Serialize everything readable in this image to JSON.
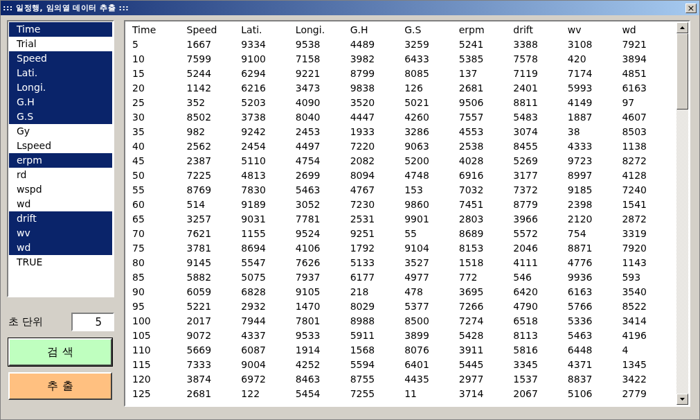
{
  "window": {
    "title": "::: 일정행, 임의열 데이터 추출 :::",
    "close": "×"
  },
  "field_list": {
    "items": [
      {
        "label": "Time",
        "selected": true
      },
      {
        "label": "Trial",
        "selected": false
      },
      {
        "label": "Speed",
        "selected": true
      },
      {
        "label": "Lati.",
        "selected": true
      },
      {
        "label": "Longi.",
        "selected": true
      },
      {
        "label": "G.H",
        "selected": true
      },
      {
        "label": "G.S",
        "selected": true
      },
      {
        "label": "Gy",
        "selected": false
      },
      {
        "label": "Lspeed",
        "selected": false
      },
      {
        "label": "erpm",
        "selected": true
      },
      {
        "label": "rd",
        "selected": false
      },
      {
        "label": "wspd",
        "selected": false
      },
      {
        "label": "wd",
        "selected": false
      },
      {
        "label": "drift",
        "selected": true
      },
      {
        "label": "wv",
        "selected": true
      },
      {
        "label": "wd",
        "selected": true
      },
      {
        "label": "TRUE",
        "selected": false
      }
    ]
  },
  "interval": {
    "label": "초 단위",
    "value": "5"
  },
  "buttons": [
    {
      "label": "검 색",
      "color": "#bfffbf",
      "focused": true
    },
    {
      "label": "추 출",
      "color": "#ffc080",
      "focused": false
    }
  ],
  "table": {
    "columns": [
      "Time",
      "Speed",
      "Lati.",
      "Longi.",
      "G.H",
      "G.S",
      "erpm",
      "drift",
      "wv",
      "wd"
    ],
    "rows": [
      [
        "5",
        "1667",
        "9334",
        "9538",
        "4489",
        "3259",
        "5241",
        "3388",
        "3108",
        "7921"
      ],
      [
        "10",
        "7599",
        "9100",
        "7158",
        "3982",
        "6433",
        "5385",
        "7578",
        "420",
        "3894"
      ],
      [
        "15",
        "5244",
        "6294",
        "9221",
        "8799",
        "8085",
        "137",
        "7119",
        "7174",
        "4851"
      ],
      [
        "20",
        "1142",
        "6216",
        "3473",
        "9838",
        "126",
        "2681",
        "2401",
        "5993",
        "6163"
      ],
      [
        "25",
        "352",
        "5203",
        "4090",
        "3520",
        "5021",
        "9506",
        "8811",
        "4149",
        "97"
      ],
      [
        "30",
        "8502",
        "3738",
        "8040",
        "4447",
        "4260",
        "7557",
        "5483",
        "1887",
        "4607"
      ],
      [
        "35",
        "982",
        "9242",
        "2453",
        "1933",
        "3286",
        "4553",
        "3074",
        "38",
        "8503"
      ],
      [
        "40",
        "2562",
        "2454",
        "4497",
        "7220",
        "9063",
        "2538",
        "8455",
        "4333",
        "1138"
      ],
      [
        "45",
        "2387",
        "5110",
        "4754",
        "2082",
        "5200",
        "4028",
        "5269",
        "9723",
        "8272"
      ],
      [
        "50",
        "7225",
        "4813",
        "2699",
        "8094",
        "4748",
        "6916",
        "3177",
        "8997",
        "4128"
      ],
      [
        "55",
        "8769",
        "7830",
        "5463",
        "4767",
        "153",
        "7032",
        "7372",
        "9185",
        "7240"
      ],
      [
        "60",
        "514",
        "9189",
        "3052",
        "7230",
        "9860",
        "7451",
        "8779",
        "2398",
        "1541"
      ],
      [
        "65",
        "3257",
        "9031",
        "7781",
        "2531",
        "9901",
        "2803",
        "3966",
        "2120",
        "2872"
      ],
      [
        "70",
        "7621",
        "1155",
        "9524",
        "9251",
        "55",
        "8689",
        "5572",
        "754",
        "3319"
      ],
      [
        "75",
        "3781",
        "8694",
        "4106",
        "1792",
        "9104",
        "8153",
        "2046",
        "8871",
        "7920"
      ],
      [
        "80",
        "9145",
        "5547",
        "7626",
        "5133",
        "3527",
        "1518",
        "4111",
        "4776",
        "1143"
      ],
      [
        "85",
        "5882",
        "5075",
        "7937",
        "6177",
        "4977",
        "772",
        "546",
        "9936",
        "593"
      ],
      [
        "90",
        "6059",
        "6828",
        "9105",
        "218",
        "478",
        "3695",
        "6420",
        "6163",
        "3540"
      ],
      [
        "95",
        "5221",
        "2932",
        "1470",
        "8029",
        "5377",
        "7266",
        "4790",
        "5766",
        "8522"
      ],
      [
        "100",
        "2017",
        "7944",
        "7801",
        "8988",
        "8500",
        "7274",
        "6518",
        "5336",
        "3414"
      ],
      [
        "105",
        "9072",
        "4337",
        "9533",
        "5911",
        "3899",
        "5428",
        "8113",
        "5463",
        "4196"
      ],
      [
        "110",
        "5669",
        "6087",
        "1914",
        "1568",
        "8076",
        "3911",
        "5816",
        "6448",
        "4"
      ],
      [
        "115",
        "7333",
        "9004",
        "4252",
        "5594",
        "6401",
        "5445",
        "3345",
        "4371",
        "1345"
      ],
      [
        "120",
        "3874",
        "6972",
        "8463",
        "8755",
        "4435",
        "2977",
        "1537",
        "8837",
        "3422"
      ],
      [
        "125",
        "2681",
        "122",
        "5454",
        "7255",
        "11",
        "3714",
        "2067",
        "5106",
        "2779"
      ]
    ]
  }
}
